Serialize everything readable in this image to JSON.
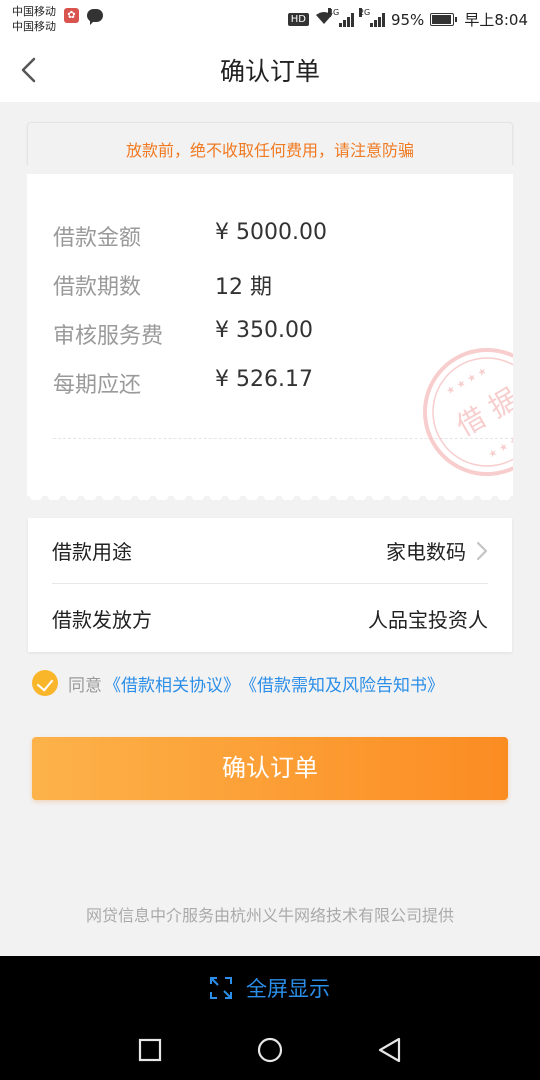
{
  "status_bar": {
    "carrier_1": "中国移动",
    "carrier_2": "中国移动",
    "hd": "HD",
    "net_1": "4G",
    "net_2": "2G",
    "battery": "95%",
    "time": "早上8:04"
  },
  "header": {
    "title": "确认订单"
  },
  "notice": {
    "warning": "放款前，绝不收取任何费用，请注意防骗"
  },
  "loan": {
    "rows": [
      {
        "label": "借款金额",
        "value": "¥ 5000.00"
      },
      {
        "label": "借款期数",
        "value": "12 期"
      },
      {
        "label": "审核服务费",
        "value": "¥ 350.00"
      },
      {
        "label": "每期应还",
        "value": "¥ 526.17"
      }
    ],
    "stamp_text": "借 据"
  },
  "details": {
    "purpose_label": "借款用途",
    "purpose_value": "家电数码",
    "lender_label": "借款发放方",
    "lender_value": "人品宝投资人"
  },
  "agreement": {
    "prefix": "同意",
    "link_1": "《借款相关协议》",
    "link_2": "《借款需知及风险告知书》",
    "checked": true
  },
  "confirm_button": "确认订单",
  "footer_note": "网贷信息中介服务由杭州义牛网络技术有限公司提供",
  "fullscreen": {
    "label": "全屏显示"
  },
  "colors": {
    "accent_orange": "#fb8c22",
    "warning_orange": "#f07a22",
    "link_blue": "#2b8ee8",
    "check_yellow": "#f9b62a"
  }
}
